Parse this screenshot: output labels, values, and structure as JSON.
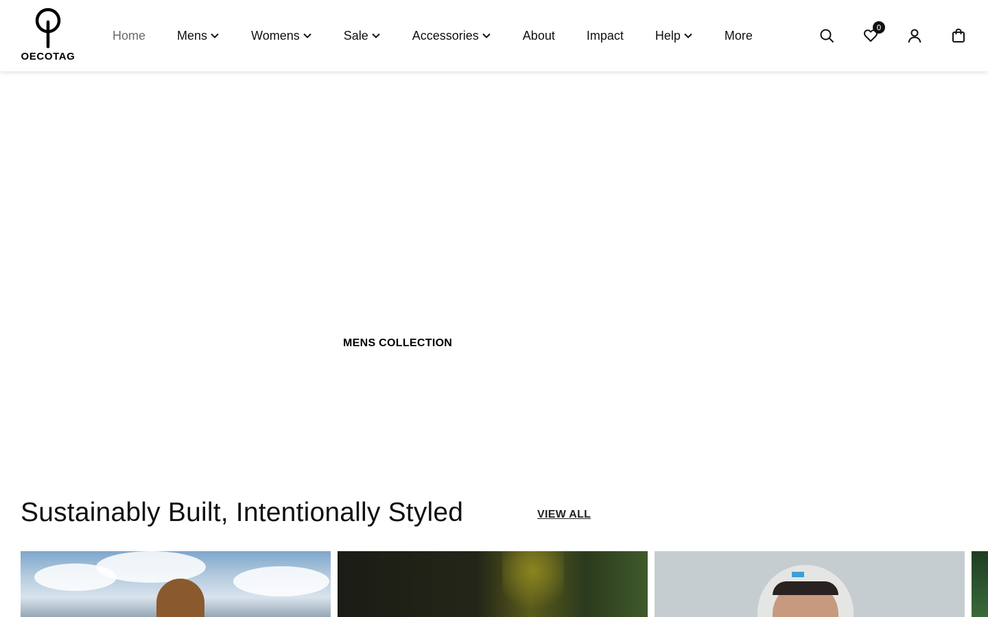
{
  "brand": {
    "name": "OECOTAG"
  },
  "nav": {
    "items": [
      {
        "label": "Home",
        "dropdown": false,
        "active": true
      },
      {
        "label": "Mens",
        "dropdown": true,
        "active": false
      },
      {
        "label": "Womens",
        "dropdown": true,
        "active": false
      },
      {
        "label": "Sale",
        "dropdown": true,
        "active": false
      },
      {
        "label": "Accessories",
        "dropdown": true,
        "active": false
      },
      {
        "label": "About",
        "dropdown": false,
        "active": false
      },
      {
        "label": "Impact",
        "dropdown": false,
        "active": false
      },
      {
        "label": "Help",
        "dropdown": true,
        "active": false
      },
      {
        "label": "More",
        "dropdown": false,
        "active": false
      }
    ]
  },
  "header_icons": {
    "search": "search-icon",
    "wishlist": "heart-icon",
    "wishlist_count": "0",
    "account": "user-icon",
    "cart": "shopping-bag-icon"
  },
  "hero": {
    "label": "MENS COLLECTION"
  },
  "section": {
    "title": "Sustainably Built, Intentionally Styled",
    "view_all": "VIEW ALL"
  },
  "colors": {
    "text": "#111111",
    "nav_active": "#6b6b6b",
    "badge_bg": "#111111"
  }
}
